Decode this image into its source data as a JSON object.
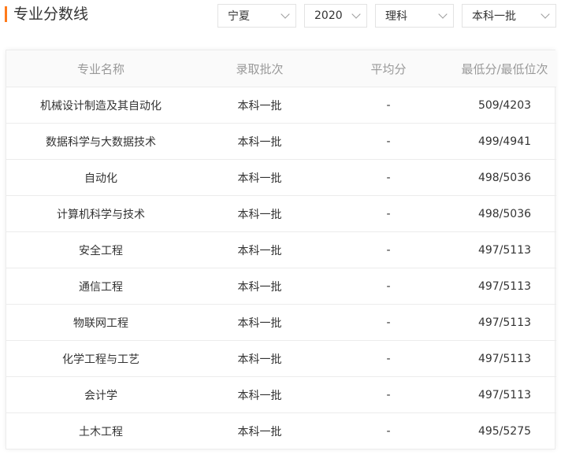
{
  "section": {
    "title": "专业分数线",
    "accent_color": "#ff7a1a"
  },
  "filters": {
    "province": "宁夏",
    "year": "2020",
    "subject": "理科",
    "batch": "本科一批"
  },
  "table": {
    "headers": [
      "专业名称",
      "录取批次",
      "平均分",
      "最低分/最低位次"
    ],
    "rows": [
      [
        "机械设计制造及其自动化",
        "本科一批",
        "-",
        "509/4203"
      ],
      [
        "数据科学与大数据技术",
        "本科一批",
        "-",
        "499/4941"
      ],
      [
        "自动化",
        "本科一批",
        "-",
        "498/5036"
      ],
      [
        "计算机科学与技术",
        "本科一批",
        "-",
        "498/5036"
      ],
      [
        "安全工程",
        "本科一批",
        "-",
        "497/5113"
      ],
      [
        "通信工程",
        "本科一批",
        "-",
        "497/5113"
      ],
      [
        "物联网工程",
        "本科一批",
        "-",
        "497/5113"
      ],
      [
        "化学工程与工艺",
        "本科一批",
        "-",
        "497/5113"
      ],
      [
        "会计学",
        "本科一批",
        "-",
        "497/5113"
      ],
      [
        "土木工程",
        "本科一批",
        "-",
        "495/5275"
      ]
    ]
  }
}
